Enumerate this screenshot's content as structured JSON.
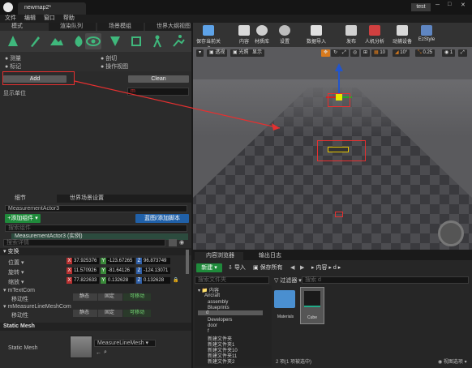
{
  "window": {
    "tab_title": "newmap2*",
    "project_tag": "test"
  },
  "menu": [
    "文件",
    "编辑",
    "窗口",
    "帮助"
  ],
  "mode_tabs": [
    "模式",
    "渲染队列",
    "场景模组",
    "世界大纲视图"
  ],
  "mode_sub": {
    "measure": "测量",
    "mark": "标记",
    "weld": "剖切",
    "op_view": "操作视图"
  },
  "measure": {
    "add_label": "Add",
    "clean_label": "Clean",
    "unit_label": "显示单位",
    "unit_value": "m"
  },
  "details_tabs": {
    "details": "细节",
    "world_settings": "世界场景设置"
  },
  "actor": {
    "name": "MeasurementActor3",
    "add_component": "+添加组件 ▾",
    "blueprint_label": "蓝图/添加脚本",
    "search_components_placeholder": "搜索组件",
    "instance_label": "MeasurementActor3 (实例)",
    "search_details_placeholder": "搜索详情"
  },
  "transform": {
    "section": "变换",
    "location_label": "位置 ▾",
    "rotation_label": "旋转 ▾",
    "scale_label": "缩放 ▾",
    "location": [
      "37.925376",
      "-123.67265",
      "96.873749"
    ],
    "rotation": [
      "11.570926",
      "-81.64126",
      "-124.13071"
    ],
    "scale": [
      "77.822633",
      "0.132628",
      "0.132628"
    ]
  },
  "mobility": {
    "label": "移动性",
    "options": [
      "静态",
      "固定",
      "可移动"
    ]
  },
  "components": {
    "text_comp": "mTextCom",
    "line_comp": "mMeasureLineMeshCom"
  },
  "static_mesh": {
    "section": "Static Mesh",
    "label": "Static Mesh",
    "value": "MeasureLineMesh"
  },
  "toolbar": [
    "保存当前关卡",
    "内容",
    "材质库",
    "设置",
    "数据导入",
    "发布",
    "人机分析",
    "动捕设备",
    "EzStyle"
  ],
  "viewport": {
    "perspective": "透视",
    "lit": "光照",
    "show": "显示",
    "grid": "10",
    "angle": "10°",
    "scale": "0.25",
    "cam": "1"
  },
  "content_browser": {
    "tabs": [
      "内容浏览器",
      "输出日志"
    ],
    "new_label": "新建 ▾",
    "import_label": "导入",
    "save_all_label": "保存所有",
    "path": [
      "内容",
      "d"
    ],
    "search_folders_placeholder": "搜索文件夹",
    "filter_label": "过滤器 ▾",
    "search_placeholder": "搜索 d",
    "tree": [
      "内容",
      "Aircraft",
      "assembly",
      "Blueprints",
      "d",
      "Developers",
      "door",
      "f",
      "新建文件夹",
      "新建文件夹1",
      "新建文件夹10",
      "新建文件夹11",
      "新建文件夹2"
    ],
    "assets": [
      "Materials",
      "Cube"
    ],
    "status": "2 项(1 项被选中)",
    "view_options": "视图选项 ▾"
  }
}
